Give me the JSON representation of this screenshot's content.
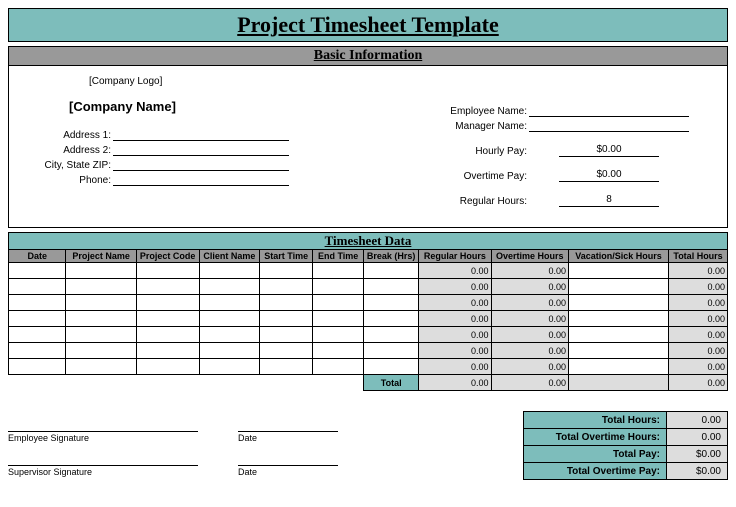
{
  "title": "Project Timesheet Template",
  "sections": {
    "basic_info": "Basic Information",
    "timesheet_data": "Timesheet Data"
  },
  "company": {
    "logo": "[Company Logo]",
    "name": "[Company Name]",
    "fields": {
      "address1": "Address 1:",
      "address2": "Address 2:",
      "city_state_zip": "City, State ZIP:",
      "phone": "Phone:"
    }
  },
  "employee_fields": {
    "employee_name": "Employee Name:",
    "manager_name": "Manager Name:",
    "hourly_pay": "Hourly Pay:",
    "overtime_pay": "Overtime Pay:",
    "regular_hours": "Regular Hours:"
  },
  "employee_values": {
    "hourly_pay": "$0.00",
    "overtime_pay": "$0.00",
    "regular_hours": "8"
  },
  "columns": {
    "date": "Date",
    "project_name": "Project Name",
    "project_code": "Project Code",
    "client_name": "Client Name",
    "start_time": "Start Time",
    "end_time": "End Time",
    "break_hrs": "Break (Hrs)",
    "regular_hours": "Regular Hours",
    "overtime_hours": "Overtime Hours",
    "vacation_sick": "Vacation/Sick Hours",
    "total_hours": "Total Hours"
  },
  "rows": [
    {
      "regular": "0.00",
      "overtime": "0.00",
      "total": "0.00"
    },
    {
      "regular": "0.00",
      "overtime": "0.00",
      "total": "0.00"
    },
    {
      "regular": "0.00",
      "overtime": "0.00",
      "total": "0.00"
    },
    {
      "regular": "0.00",
      "overtime": "0.00",
      "total": "0.00"
    },
    {
      "regular": "0.00",
      "overtime": "0.00",
      "total": "0.00"
    },
    {
      "regular": "0.00",
      "overtime": "0.00",
      "total": "0.00"
    },
    {
      "regular": "0.00",
      "overtime": "0.00",
      "total": "0.00"
    }
  ],
  "totals_row": {
    "label": "Total",
    "regular": "0.00",
    "overtime": "0.00",
    "total": "0.00"
  },
  "summary": {
    "total_hours": {
      "label": "Total Hours:",
      "value": "0.00"
    },
    "total_overtime_hours": {
      "label": "Total Overtime Hours:",
      "value": "0.00"
    },
    "total_pay": {
      "label": "Total Pay:",
      "value": "$0.00"
    },
    "total_overtime_pay": {
      "label": "Total Overtime Pay:",
      "value": "$0.00"
    }
  },
  "signatures": {
    "employee": "Employee Signature",
    "supervisor": "Supervisor Signature",
    "date": "Date"
  }
}
